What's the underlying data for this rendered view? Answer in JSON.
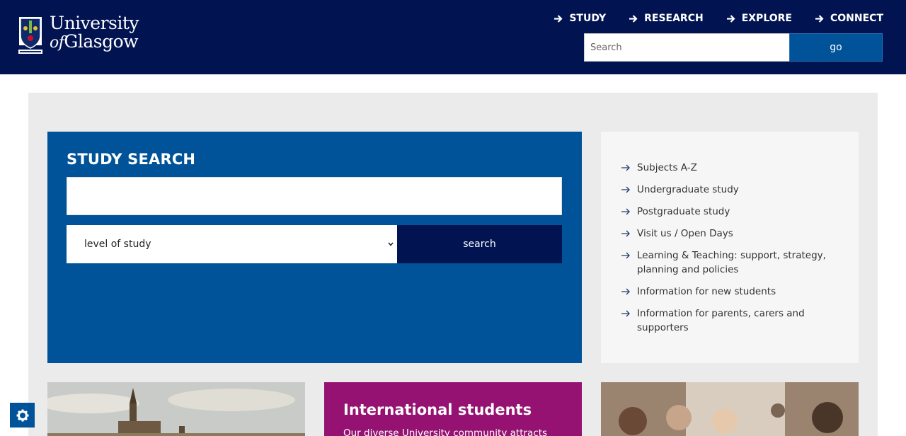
{
  "header": {
    "logo_line1": "University",
    "logo_of": "of",
    "logo_line2": "Glasgow",
    "nav": [
      "STUDY",
      "RESEARCH",
      "EXPLORE",
      "CONNECT"
    ],
    "search_placeholder": "Search",
    "search_button": "go"
  },
  "study": {
    "title": "STUDY SEARCH",
    "level_placeholder": "level of study",
    "search_button": "search"
  },
  "links": [
    "Subjects A-Z",
    "Undergraduate study",
    "Postgraduate study",
    "Visit us / Open Days",
    "Learning & Teaching: support, strategy, planning and policies",
    "Information for new students",
    "Information for parents, carers and supporters"
  ],
  "tiles": {
    "international_title": "International students",
    "international_text": "Our diverse University community attracts"
  },
  "colors": {
    "header_bg": "#011451",
    "study_blue": "#005398",
    "purple": "#951272",
    "panel_grey": "#ebebeb"
  }
}
